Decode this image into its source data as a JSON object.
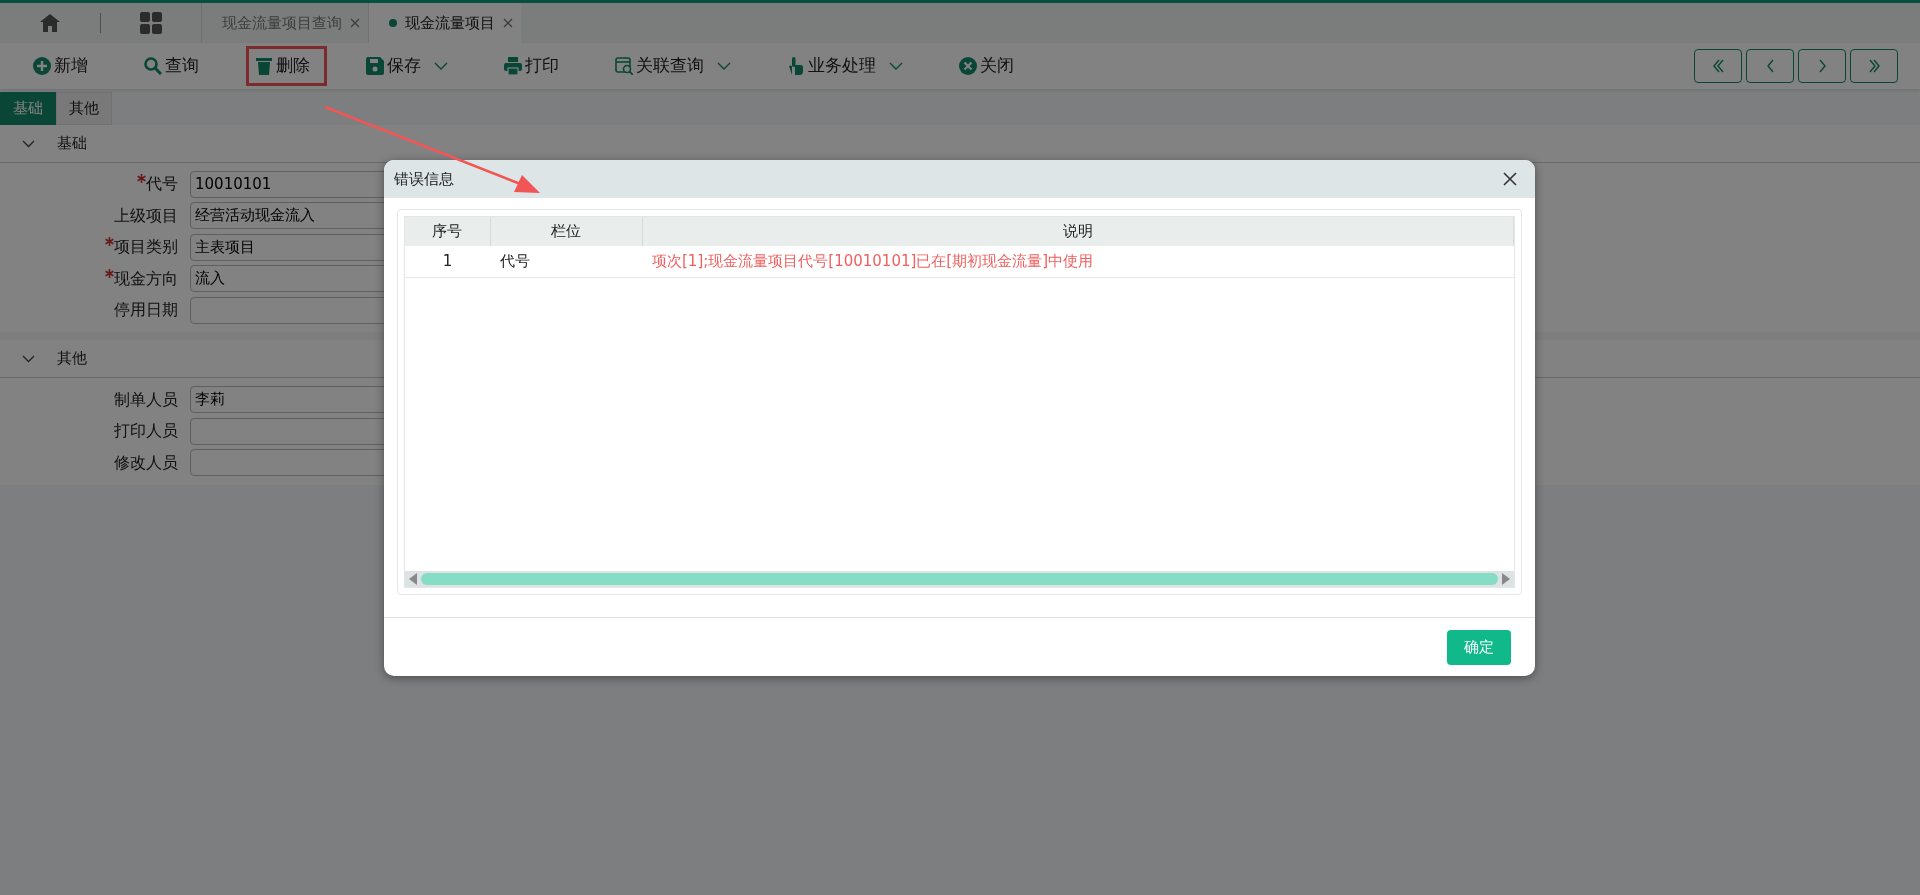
{
  "top_tabs": [
    {
      "label": "现金流量项目查询",
      "selected": false
    },
    {
      "label": "现金流量项目",
      "selected": true
    }
  ],
  "toolbar": [
    {
      "label": "新增",
      "dropdown": false,
      "highlighted": false
    },
    {
      "label": "查询",
      "dropdown": false,
      "highlighted": false
    },
    {
      "label": "删除",
      "dropdown": false,
      "highlighted": true
    },
    {
      "label": "保存",
      "dropdown": true,
      "highlighted": false
    },
    {
      "label": "打印",
      "dropdown": false,
      "highlighted": false
    },
    {
      "label": "关联查询",
      "dropdown": true,
      "highlighted": false
    },
    {
      "label": "业务处理",
      "dropdown": true,
      "highlighted": false
    },
    {
      "label": "关闭",
      "dropdown": false,
      "highlighted": false
    }
  ],
  "form_tabs": [
    {
      "label": "基础",
      "selected": true
    },
    {
      "label": "其他",
      "selected": false
    }
  ],
  "sections": [
    {
      "title": "基础",
      "expanded": true,
      "fields": [
        {
          "label": "代号",
          "required": true,
          "value": "10010101"
        },
        {
          "label": "上级项目",
          "required": false,
          "value": "经营活动现金流入"
        },
        {
          "label": "项目类别",
          "required": true,
          "value": "主表项目"
        },
        {
          "label": "现金方向",
          "required": true,
          "value": "流入"
        },
        {
          "label": "停用日期",
          "required": false
        }
      ]
    },
    {
      "title": "其他",
      "expanded": true,
      "fields": [
        {
          "label": "制单人员",
          "required": false,
          "value": "李莉"
        },
        {
          "label": "打印人员",
          "required": false
        },
        {
          "label": "修改人员",
          "required": false
        }
      ]
    }
  ],
  "dialog": {
    "title": "错误信息",
    "columns": [
      "序号",
      "栏位",
      "说明"
    ],
    "rows": [
      [
        "1",
        "代号",
        "项次[1];现金流量项目代号[10010101]已在[期初现金流量]中使用"
      ]
    ],
    "confirm": "确定"
  }
}
